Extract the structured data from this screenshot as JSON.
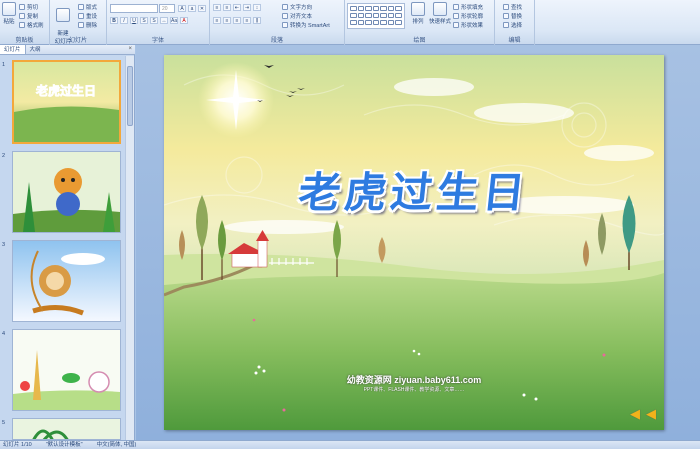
{
  "ribbon": {
    "clipboard": {
      "label": "剪贴板",
      "paste": "粘贴",
      "cut": "剪切",
      "copy": "复制",
      "format_painter": "格式刷"
    },
    "slides": {
      "label": "幻灯片",
      "new_slide": "新建\n幻灯片",
      "layout": "版式",
      "reset": "重设",
      "delete": "删除"
    },
    "font": {
      "label": "字体",
      "font_size": "20"
    },
    "paragraph": {
      "label": "段落",
      "text_direction": "文字方向",
      "align_text": "对齐文本",
      "smartart": "转换为 SmartArt"
    },
    "drawing": {
      "label": "绘图",
      "arrange": "排列",
      "quick_styles": "快速样式",
      "shape_fill": "形状填充",
      "shape_outline": "形状轮廓",
      "shape_effects": "形状效果"
    },
    "editing": {
      "label": "编辑",
      "find": "查找",
      "replace": "替换",
      "select": "选择"
    }
  },
  "pane": {
    "tab_slides": "幻灯片",
    "tab_outline": "大纲",
    "thumbnails": [
      {
        "num": "1"
      },
      {
        "num": "2"
      },
      {
        "num": "3"
      },
      {
        "num": "4"
      },
      {
        "num": "5"
      }
    ]
  },
  "slide": {
    "title": "老虎过生日",
    "watermark_line1": "幼教资源网 ziyuan.baby611.com",
    "watermark_line2": "PPT课件、FLASH课件、教学资源、文章……"
  },
  "status": {
    "slide_count": "幻灯片 1/10",
    "theme": "\"默认设计模板\"",
    "language": "中文(简体, 中国)"
  },
  "colors": {
    "title_blue": "#2e7be0",
    "selection_orange": "#f3a83b"
  }
}
